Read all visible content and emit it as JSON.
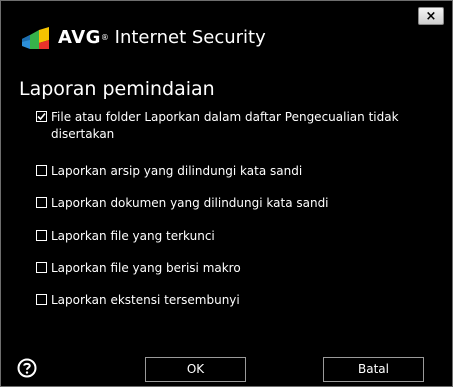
{
  "titlebar": {
    "brand": "AVG",
    "registered": "®",
    "product": "Internet Security",
    "close_label": "×"
  },
  "dialog": {
    "heading": "Laporan pemindaian",
    "options": [
      {
        "label": "File atau folder Laporkan dalam daftar Pengecualian tidak disertakan",
        "checked": true
      },
      {
        "label": "Laporkan arsip yang dilindungi kata sandi",
        "checked": false
      },
      {
        "label": "Laporkan dokumen yang dilindungi kata sandi",
        "checked": false
      },
      {
        "label": "Laporkan file yang terkunci",
        "checked": false
      },
      {
        "label": "Laporkan file yang berisi makro",
        "checked": false
      },
      {
        "label": "Laporkan ekstensi tersembunyi",
        "checked": false
      }
    ]
  },
  "footer": {
    "ok_label": "OK",
    "cancel_label": "Batal"
  }
}
